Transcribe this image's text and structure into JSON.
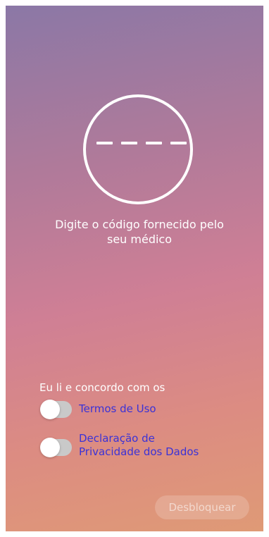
{
  "code_entry": {
    "prompt_line1": "Digite o código fornecido pelo",
    "prompt_line2": "seu médico",
    "icon": "code-circle-icon"
  },
  "agreement": {
    "label": "Eu li e concordo com os",
    "terms": {
      "label": "Termos de Uso",
      "enabled": false
    },
    "privacy": {
      "label_line1": "Declaração de",
      "label_line2": "Privacidade dos Dados",
      "enabled": false
    }
  },
  "actions": {
    "unlock_label": "Desbloquear",
    "unlock_enabled": false
  },
  "colors": {
    "gradient_top": "#8b78a6",
    "gradient_bottom": "#df9a76",
    "link": "#3b32d6"
  }
}
